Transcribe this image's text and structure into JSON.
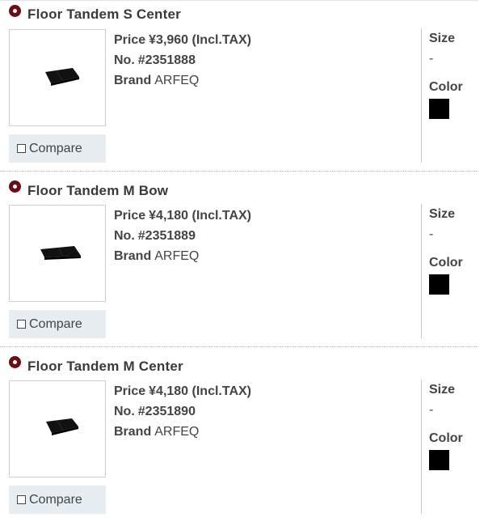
{
  "products": [
    {
      "title": "Floor Tandem S Center",
      "price_label": "Price",
      "price": "¥3,960 (Incl.TAX)",
      "no_label": "No.",
      "number": "#2351888",
      "brand_label": "Brand",
      "brand": "ARFEQ",
      "size_label": "Size",
      "size_value": "-",
      "color_label": "Color",
      "color_swatch": "#000000",
      "compare_label": "Compare",
      "image_icon": "floor-panel-icon"
    },
    {
      "title": "Floor Tandem M Bow",
      "price_label": "Price",
      "price": "¥4,180 (Incl.TAX)",
      "no_label": "No.",
      "number": "#2351889",
      "brand_label": "Brand",
      "brand": "ARFEQ",
      "size_label": "Size",
      "size_value": "-",
      "color_label": "Color",
      "color_swatch": "#000000",
      "compare_label": "Compare",
      "image_icon": "floor-panel-icon"
    },
    {
      "title": "Floor Tandem M Center",
      "price_label": "Price",
      "price": "¥4,180 (Incl.TAX)",
      "no_label": "No.",
      "number": "#2351890",
      "brand_label": "Brand",
      "brand": "ARFEQ",
      "size_label": "Size",
      "size_value": "-",
      "color_label": "Color",
      "color_swatch": "#000000",
      "compare_label": "Compare",
      "image_icon": "floor-panel-icon"
    }
  ],
  "colors": {
    "bullet": "#6b0d14",
    "compare_bg": "#e8edf1"
  }
}
